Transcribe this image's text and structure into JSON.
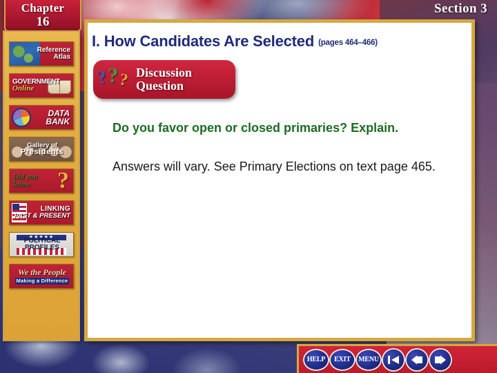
{
  "chapter_banner": {
    "word": "Chapter",
    "number": "16"
  },
  "section_label": "Section 3",
  "sidebar": {
    "items": [
      {
        "name": "reference-atlas",
        "line1": "Reference",
        "line2": "Atlas",
        "icon": "globe-icon"
      },
      {
        "name": "government-online",
        "line1": "GOVERNMENT",
        "line2": "Online",
        "icon": "open-book-icon"
      },
      {
        "name": "data-bank",
        "line1": "DATA",
        "line2": "BANK",
        "icon": "pie-chart-icon"
      },
      {
        "name": "gallery-of-presidents",
        "line1": "Gallery of",
        "line2": "Presidents",
        "icon": "president-portraits-icon"
      },
      {
        "name": "did-you-know",
        "line1": "Did you",
        "line2": "know",
        "icon": "question-mark-icon"
      },
      {
        "name": "linking-past-and-present",
        "line1": "LINKING",
        "line2": "PAST & PRESENT",
        "icon": "flag-icon"
      },
      {
        "name": "political-profiles",
        "line1": "POLITICAL",
        "line2": "PROFILES",
        "icon": "stars-and-stripes-icon"
      },
      {
        "name": "we-the-people",
        "line1": "We the People",
        "line2": "Making a Difference",
        "icon": "none"
      }
    ]
  },
  "main": {
    "heading": "I.  How Candidates Are Selected",
    "pages": "(pages 464–466)",
    "discussion_banner": {
      "line1": "Discussion",
      "line2": "Question"
    },
    "question": "Do you favor open or closed primaries? Explain.",
    "answer": "Answers will vary. See Primary Elections on text page 465."
  },
  "nav": {
    "help": "HELP",
    "exit": "EXIT",
    "menu": "MENU",
    "first_icon": "first-slide-icon",
    "back_icon": "previous-slide-icon",
    "forward_icon": "next-slide-icon"
  },
  "colors": {
    "gold": "#d6a840",
    "red": "#bb1c33",
    "navy": "#1f2a7a",
    "green": "#1d6b22",
    "button_blue": "#1f2a86"
  }
}
